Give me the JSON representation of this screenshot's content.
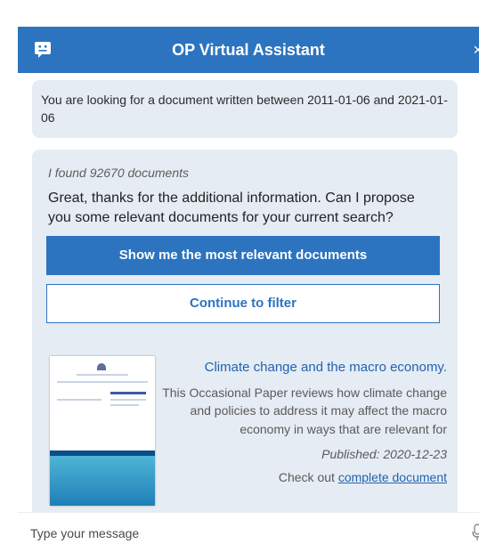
{
  "header": {
    "title": "OP Virtual Assistant",
    "icon": "chat-bubble-icon",
    "close_label": "×"
  },
  "messages": {
    "criteria_text": "You are looking for a document written between 2011-01-06 and 2021-01-06",
    "found_text": "I found 92670 documents",
    "question_text": "Great, thanks for the additional information. Can I propose you some relevant documents for your current search?",
    "buttons": {
      "primary": "Show me the most relevant documents",
      "secondary": "Continue to filter"
    }
  },
  "document": {
    "title": "Climate change and the macro economy.",
    "summary": "This Occasional Paper reviews how climate change and policies to address it may affect the macro economy in ways that are relevant for",
    "published": "Published: 2020-12-23",
    "check_prefix": "Check out ",
    "link_text": "complete document"
  },
  "input": {
    "placeholder": "Type your message"
  },
  "colors": {
    "accent": "#2c74bf",
    "bubble": "#e6ecf3",
    "link": "#1e63b3"
  }
}
